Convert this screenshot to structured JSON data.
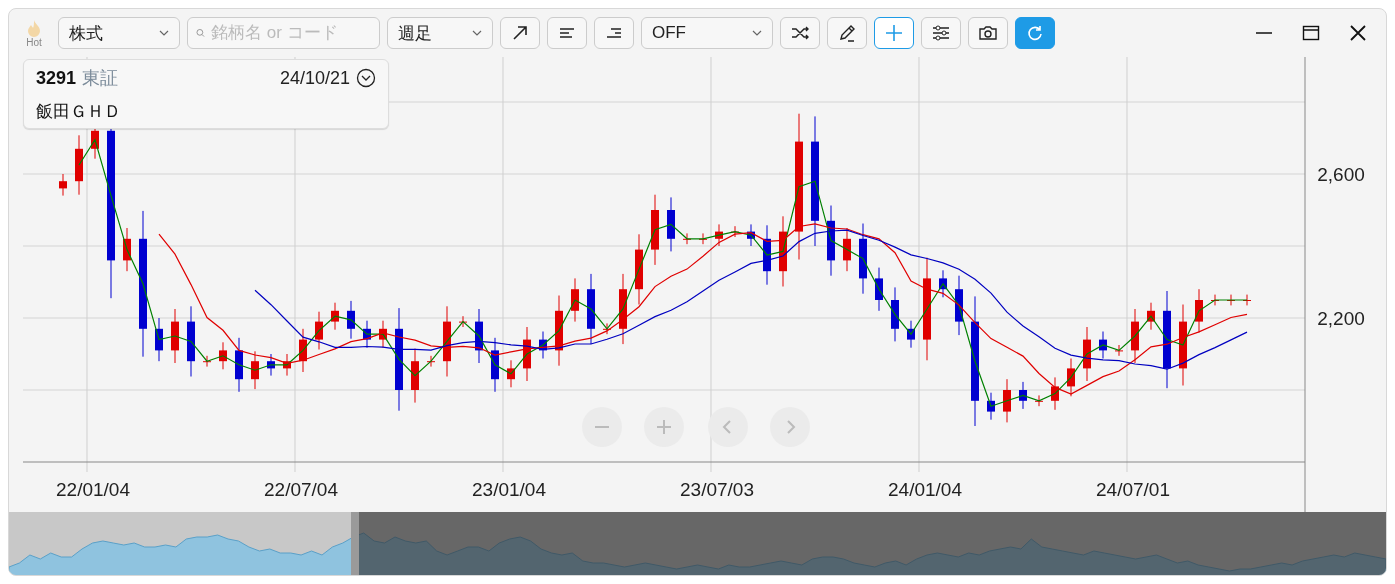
{
  "toolbar": {
    "hot_label": "Hot",
    "market_select": {
      "value": "株式"
    },
    "search": {
      "placeholder": "銘柄名 or コード"
    },
    "period_select": {
      "value": "週足"
    },
    "drawing_tools": [
      {
        "kind": "trend-line",
        "selected": false
      },
      {
        "kind": "align-left",
        "selected": false
      },
      {
        "kind": "align-right",
        "selected": false
      }
    ],
    "indicator_select": {
      "value": "OFF"
    },
    "tools": [
      {
        "kind": "shuffle",
        "selected": false
      },
      {
        "kind": "pencil",
        "selected": false
      },
      {
        "kind": "crosshair",
        "selected": true
      },
      {
        "kind": "sliders",
        "selected": false
      },
      {
        "kind": "camera",
        "selected": false
      },
      {
        "kind": "refresh",
        "selected": false
      }
    ]
  },
  "info_card": {
    "code": "3291",
    "exchange": "東証",
    "date": "24/10/21",
    "name": "飯田ＧＨＤ"
  },
  "chart": {
    "x_labels": [
      "22/01/04",
      "22/07/04",
      "23/01/04",
      "23/07/03",
      "24/01/04",
      "24/07/01"
    ],
    "y_labels": [
      "2,600",
      "2,200"
    ]
  }
}
